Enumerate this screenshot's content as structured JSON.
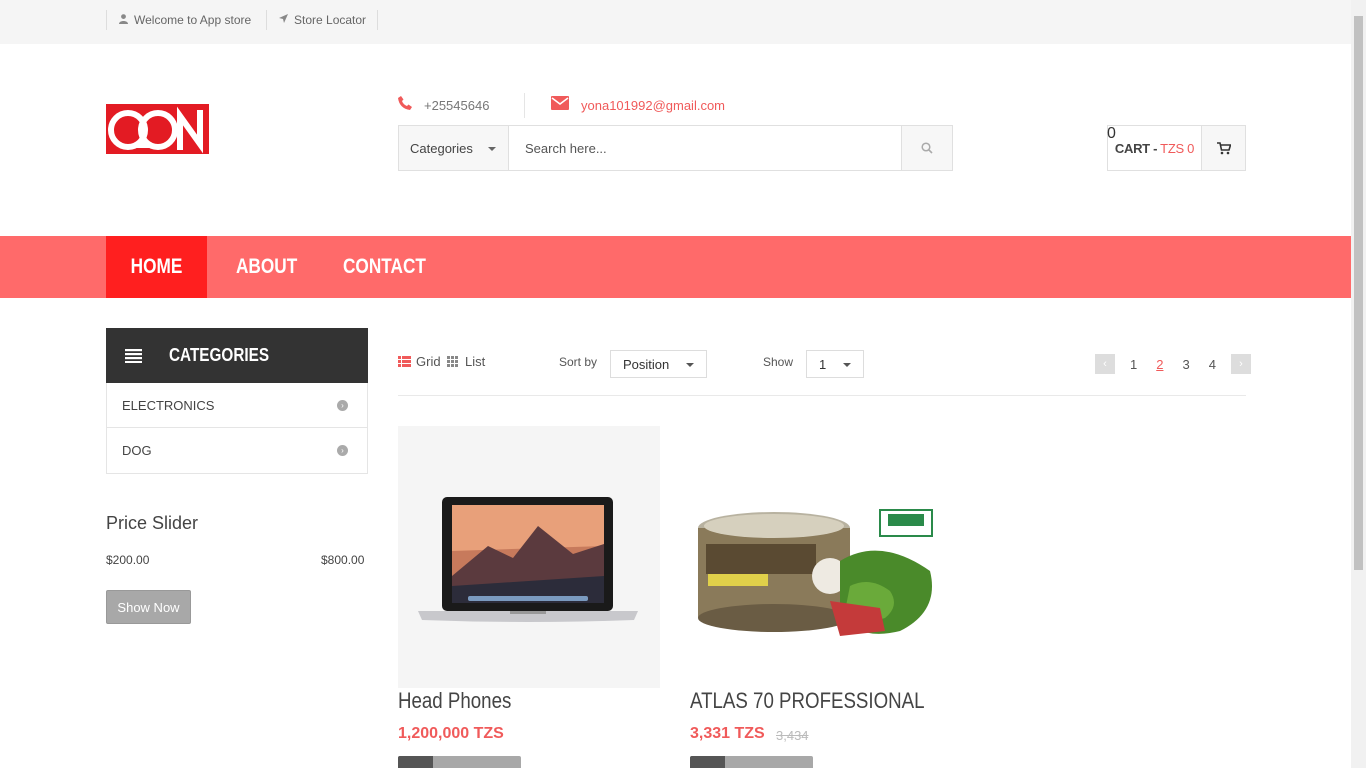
{
  "topbar": {
    "welcome": "Welcome to App store",
    "store_locator": "Store Locator"
  },
  "header": {
    "phone": "+25545646",
    "email": "yona101992@gmail.com",
    "search": {
      "category": "Categories",
      "placeholder": "Search here..."
    },
    "cart": {
      "label": "CART -",
      "amount": "TZS 0",
      "count": "0"
    }
  },
  "nav": {
    "items": [
      {
        "label": "HOME"
      },
      {
        "label": "ABOUT"
      },
      {
        "label": "CONTACT"
      }
    ]
  },
  "sidebar": {
    "categories_title": "CATEGORIES",
    "categories": [
      {
        "label": "ELECTRONICS"
      },
      {
        "label": "DOG"
      }
    ],
    "price_slider": {
      "title": "Price Slider",
      "min": "$200.00",
      "max": "$800.00",
      "button": "Show Now"
    }
  },
  "toolbar": {
    "grid": "Grid",
    "list": "List",
    "sort_label": "Sort by",
    "sort_value": "Position",
    "show_label": "Show",
    "show_value": "1",
    "pages": [
      "1",
      "2",
      "3",
      "4"
    ],
    "active_page": "2"
  },
  "products": [
    {
      "name": "Head Phones",
      "price": "1,200,000 TZS",
      "old_price": ""
    },
    {
      "name": "ATLAS 70 PROFESSIONAL",
      "price": "3,331 TZS",
      "old_price": "3,434"
    }
  ],
  "colors": {
    "accent": "#f05a5a",
    "nav": "#ff6a6a",
    "nav_active": "#ff1f1f",
    "logo": "#e31b23",
    "dark": "#333333"
  }
}
